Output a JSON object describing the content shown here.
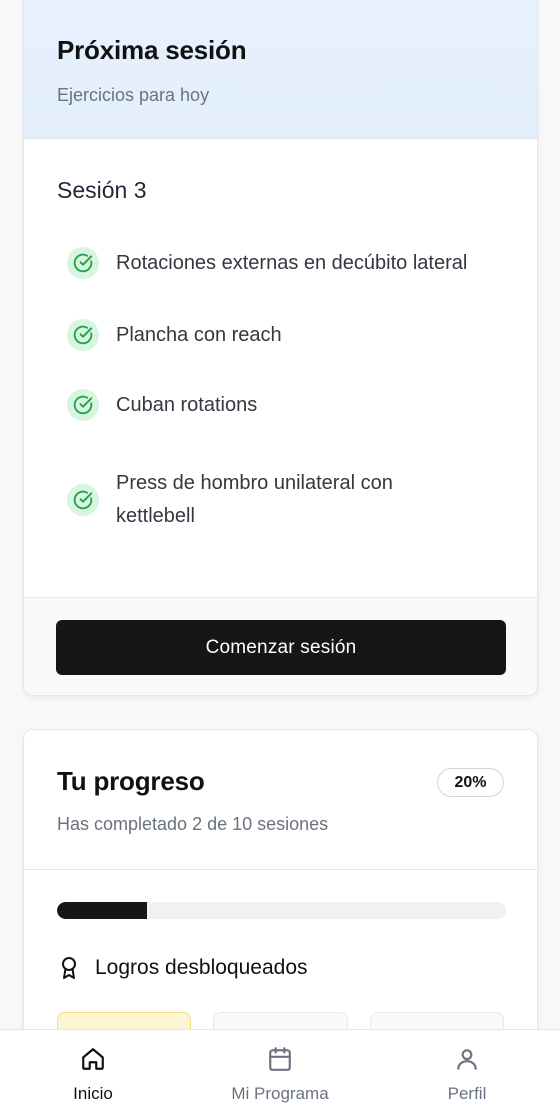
{
  "session": {
    "title": "Próxima sesión",
    "subtitle": "Ejercicios para hoy",
    "session_name": "Sesión 3",
    "exercises": [
      {
        "label": "Rotaciones externas en decúbito lateral",
        "icon": "check-circle-icon"
      },
      {
        "label": "Plancha con reach",
        "icon": "check-circle-icon"
      },
      {
        "label": "Cuban rotations",
        "icon": "check-circle-icon"
      },
      {
        "label": "Press de hombro unilateral con kettlebell",
        "icon": "check-circle-icon"
      }
    ],
    "start_button_label": "Comenzar sesión"
  },
  "progress": {
    "title": "Tu progreso",
    "percent_label": "20%",
    "percent_value": 0.2,
    "summary": "Has completado 2 de 10 sesiones",
    "achievements_title": "Logros desbloqueados",
    "achievements_icon": "award-icon"
  },
  "nav": {
    "items": [
      {
        "label": "Inicio",
        "icon": "home-icon",
        "active": true
      },
      {
        "label": "Mi Programa",
        "icon": "calendar-icon",
        "active": false
      },
      {
        "label": "Perfil",
        "icon": "user-icon",
        "active": false
      }
    ]
  },
  "colors": {
    "accent": "#161616",
    "check_bg": "#d7f5df",
    "check_stroke": "#22a24a",
    "header_bg": "#e6f0fd",
    "badge_unlocked": "#fdf5d1"
  }
}
